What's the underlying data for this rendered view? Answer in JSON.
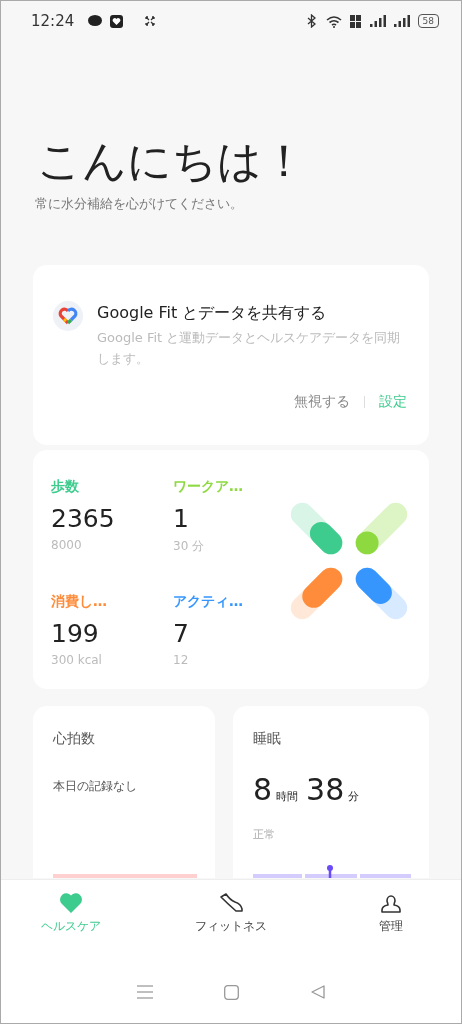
{
  "status_bar": {
    "time": "12:24",
    "battery": "58"
  },
  "greeting": {
    "title": "こんにちは！",
    "subtitle": "常に水分補給を心がけてください。"
  },
  "fit_card": {
    "title": "Google Fit とデータを共有する",
    "description": "Google Fit と運動データとヘルスケアデータを同期します。",
    "dismiss": "無視する",
    "settings": "設定"
  },
  "stats": [
    {
      "label": "歩数",
      "value": "2365",
      "goal": "8000",
      "color": "#3dcc8e"
    },
    {
      "label": "ワークア…",
      "value": "1",
      "goal": "30 分",
      "color": "#8ed940"
    },
    {
      "label": "消費し…",
      "value": "199",
      "goal": "300 kcal",
      "color": "#fe8c3a"
    },
    {
      "label": "アクティ…",
      "value": "7",
      "goal": "12",
      "color": "#3796fe"
    }
  ],
  "heart_card": {
    "title": "心拍数",
    "message": "本日の記録なし"
  },
  "sleep_card": {
    "title": "睡眠",
    "hours": "8",
    "hours_unit": "時間",
    "minutes": "38",
    "minutes_unit": "分",
    "quality": "正常"
  },
  "tabs": [
    {
      "label": "ヘルスケア",
      "kind": "heart",
      "selected": true
    },
    {
      "label": "フィットネス",
      "kind": "shoe",
      "selected": false
    },
    {
      "label": "管理",
      "kind": "person",
      "selected": false
    }
  ]
}
